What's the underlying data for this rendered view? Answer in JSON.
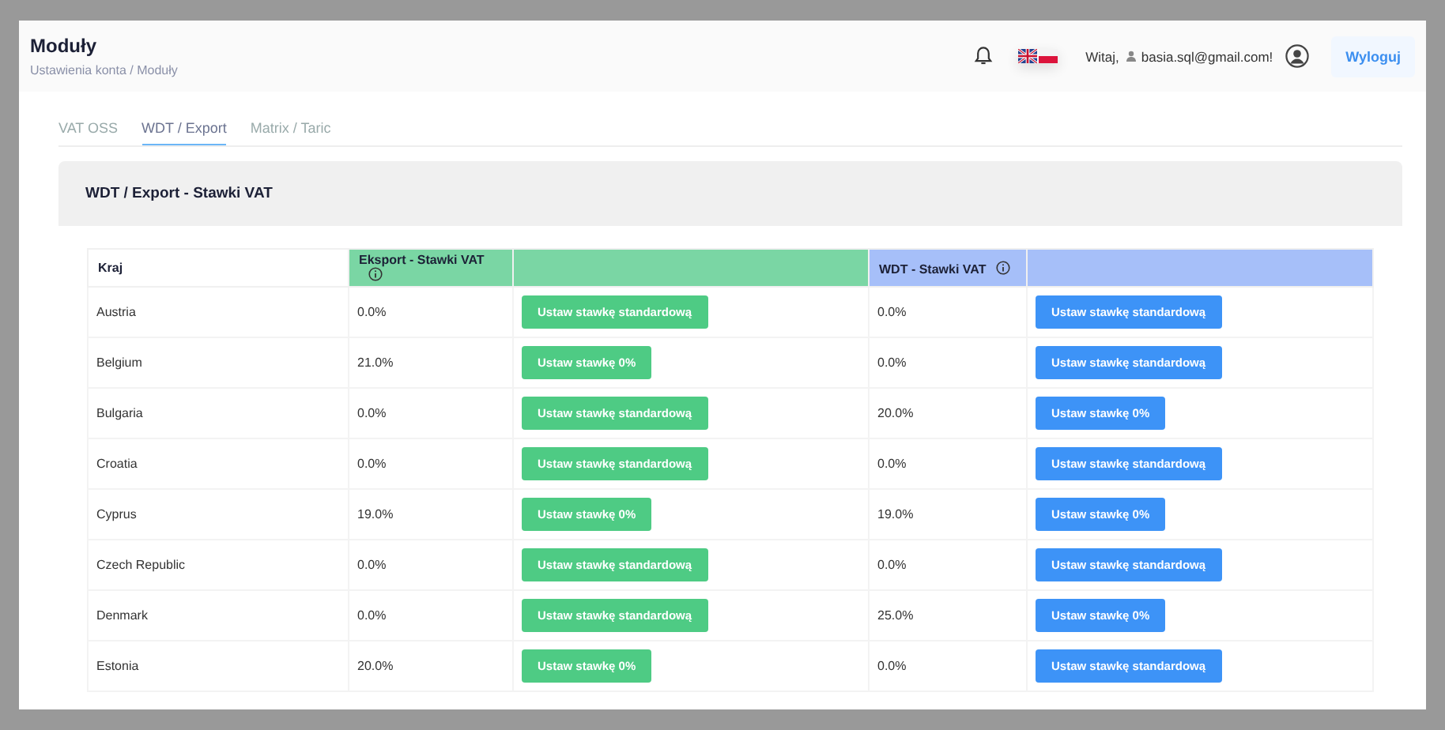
{
  "header": {
    "title": "Moduły",
    "breadcrumb": "Ustawienia konta / Moduły",
    "greeting": "Witaj,",
    "user": "basia.sql@gmail.com!",
    "logout": "Wyloguj"
  },
  "tabs": [
    {
      "label": "VAT OSS",
      "selected": false
    },
    {
      "label": "WDT / Export",
      "selected": true
    },
    {
      "label": "Matrix / Taric",
      "selected": false
    }
  ],
  "card": {
    "title": "WDT / Export - Stawki VAT"
  },
  "table": {
    "columns": [
      {
        "label": "Kraj",
        "kind": "plain"
      },
      {
        "label": "Eksport - Stawki VAT",
        "kind": "export"
      },
      {
        "kind": "export"
      },
      {
        "label": "WDT - Stawki VAT",
        "kind": "wdt"
      },
      {
        "kind": "wdt"
      }
    ],
    "rows": [
      {
        "country": "Austria",
        "export_rate": "0.0%",
        "export_action": "Ustaw stawkę standardową",
        "wdt_rate": "0.0%",
        "wdt_action": "Ustaw stawkę standardową"
      },
      {
        "country": "Belgium",
        "export_rate": "21.0%",
        "export_action": "Ustaw stawkę 0%",
        "wdt_rate": "0.0%",
        "wdt_action": "Ustaw stawkę standardową"
      },
      {
        "country": "Bulgaria",
        "export_rate": "0.0%",
        "export_action": "Ustaw stawkę standardową",
        "wdt_rate": "20.0%",
        "wdt_action": "Ustaw stawkę 0%"
      },
      {
        "country": "Croatia",
        "export_rate": "0.0%",
        "export_action": "Ustaw stawkę standardową",
        "wdt_rate": "0.0%",
        "wdt_action": "Ustaw stawkę standardową"
      },
      {
        "country": "Cyprus",
        "export_rate": "19.0%",
        "export_action": "Ustaw stawkę 0%",
        "wdt_rate": "19.0%",
        "wdt_action": "Ustaw stawkę 0%"
      },
      {
        "country": "Czech Republic",
        "export_rate": "0.0%",
        "export_action": "Ustaw stawkę standardową",
        "wdt_rate": "0.0%",
        "wdt_action": "Ustaw stawkę standardową"
      },
      {
        "country": "Denmark",
        "export_rate": "0.0%",
        "export_action": "Ustaw stawkę standardową",
        "wdt_rate": "25.0%",
        "wdt_action": "Ustaw stawkę 0%"
      },
      {
        "country": "Estonia",
        "export_rate": "20.0%",
        "export_action": "Ustaw stawkę 0%",
        "wdt_rate": "0.0%",
        "wdt_action": "Ustaw stawkę standardową"
      }
    ]
  }
}
